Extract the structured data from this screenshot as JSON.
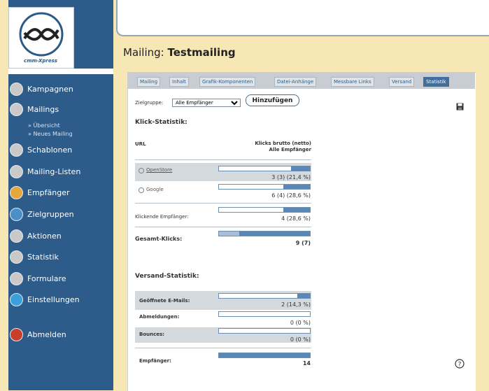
{
  "app": {
    "logo_text": "cmm-Xpress"
  },
  "sidebar": {
    "items": [
      {
        "label": "Kampagnen",
        "icon": "campaign-icon",
        "color": "#c9c9c9"
      },
      {
        "label": "Mailings",
        "icon": "mailings-icon",
        "color": "#c9c9c9"
      },
      {
        "label": "Schablonen",
        "icon": "template-icon",
        "color": "#c9c9c9"
      },
      {
        "label": "Mailing-Listen",
        "icon": "mailing-list-icon",
        "color": "#c9c9c9"
      },
      {
        "label": "Empfänger",
        "icon": "recipient-icon",
        "color": "#e8a53a"
      },
      {
        "label": "Zielgruppen",
        "icon": "target-groups-icon",
        "color": "#4b8fc7"
      },
      {
        "label": "Aktionen",
        "icon": "actions-icon",
        "color": "#c9c9c9"
      },
      {
        "label": "Statistik",
        "icon": "statistics-icon",
        "color": "#c9c9c9"
      },
      {
        "label": "Formulare",
        "icon": "forms-icon",
        "color": "#c9c9c9"
      },
      {
        "label": "Einstellungen",
        "icon": "settings-icon",
        "color": "#3aa0d8"
      },
      {
        "label": "Abmelden",
        "icon": "logout-icon",
        "color": "#c8402d"
      }
    ],
    "sub_items": [
      "» Übersicht",
      "» Neues Mailing"
    ]
  },
  "page": {
    "title_prefix": "Mailing:",
    "title_name": "Testmailing"
  },
  "tabs": [
    {
      "label": "Mailing",
      "active": false
    },
    {
      "label": "Inhalt",
      "active": false
    },
    {
      "label": "Grafik-Komponenten",
      "active": false
    },
    {
      "label": "Datei-Anhänge",
      "active": false
    },
    {
      "label": "Messbare Links",
      "active": false
    },
    {
      "label": "Versand",
      "active": false
    },
    {
      "label": "Statistik",
      "active": true
    }
  ],
  "filter": {
    "label": "Zielgruppe:",
    "selected": "Alle Empfänger",
    "button": "Hinzufügen"
  },
  "click_stats": {
    "heading": "Klick-Statistik:",
    "col_url": "URL",
    "col_clicks_line1": "Klicks brutto (netto)",
    "col_clicks_line2": "Alle Empfänger",
    "rows": [
      {
        "label": "OpenStore",
        "value": "3 (3)  (21,4 %)",
        "fill": 0.21
      },
      {
        "label": "Google",
        "value": "6 (4)  (28,6 %)",
        "fill": 0.29
      },
      {
        "label": "Klickende Empfänger:",
        "value": "4  (28,6 %)",
        "fill": 0.29
      }
    ],
    "total_label": "Gesamt-Klicks:",
    "total_value": "9 (7)"
  },
  "send_stats": {
    "heading": "Versand-Statistik:",
    "rows": [
      {
        "label": "Geöffnete E-Mails:",
        "value": "2  (14,3 %)",
        "fill": 0.14
      },
      {
        "label": "Abmeldungen:",
        "value": "0  (0 %)",
        "fill": 0
      },
      {
        "label": "Bounces:",
        "value": "0  (0 %)",
        "fill": 0
      }
    ],
    "total_label": "Empfänger:",
    "total_value": "14"
  }
}
